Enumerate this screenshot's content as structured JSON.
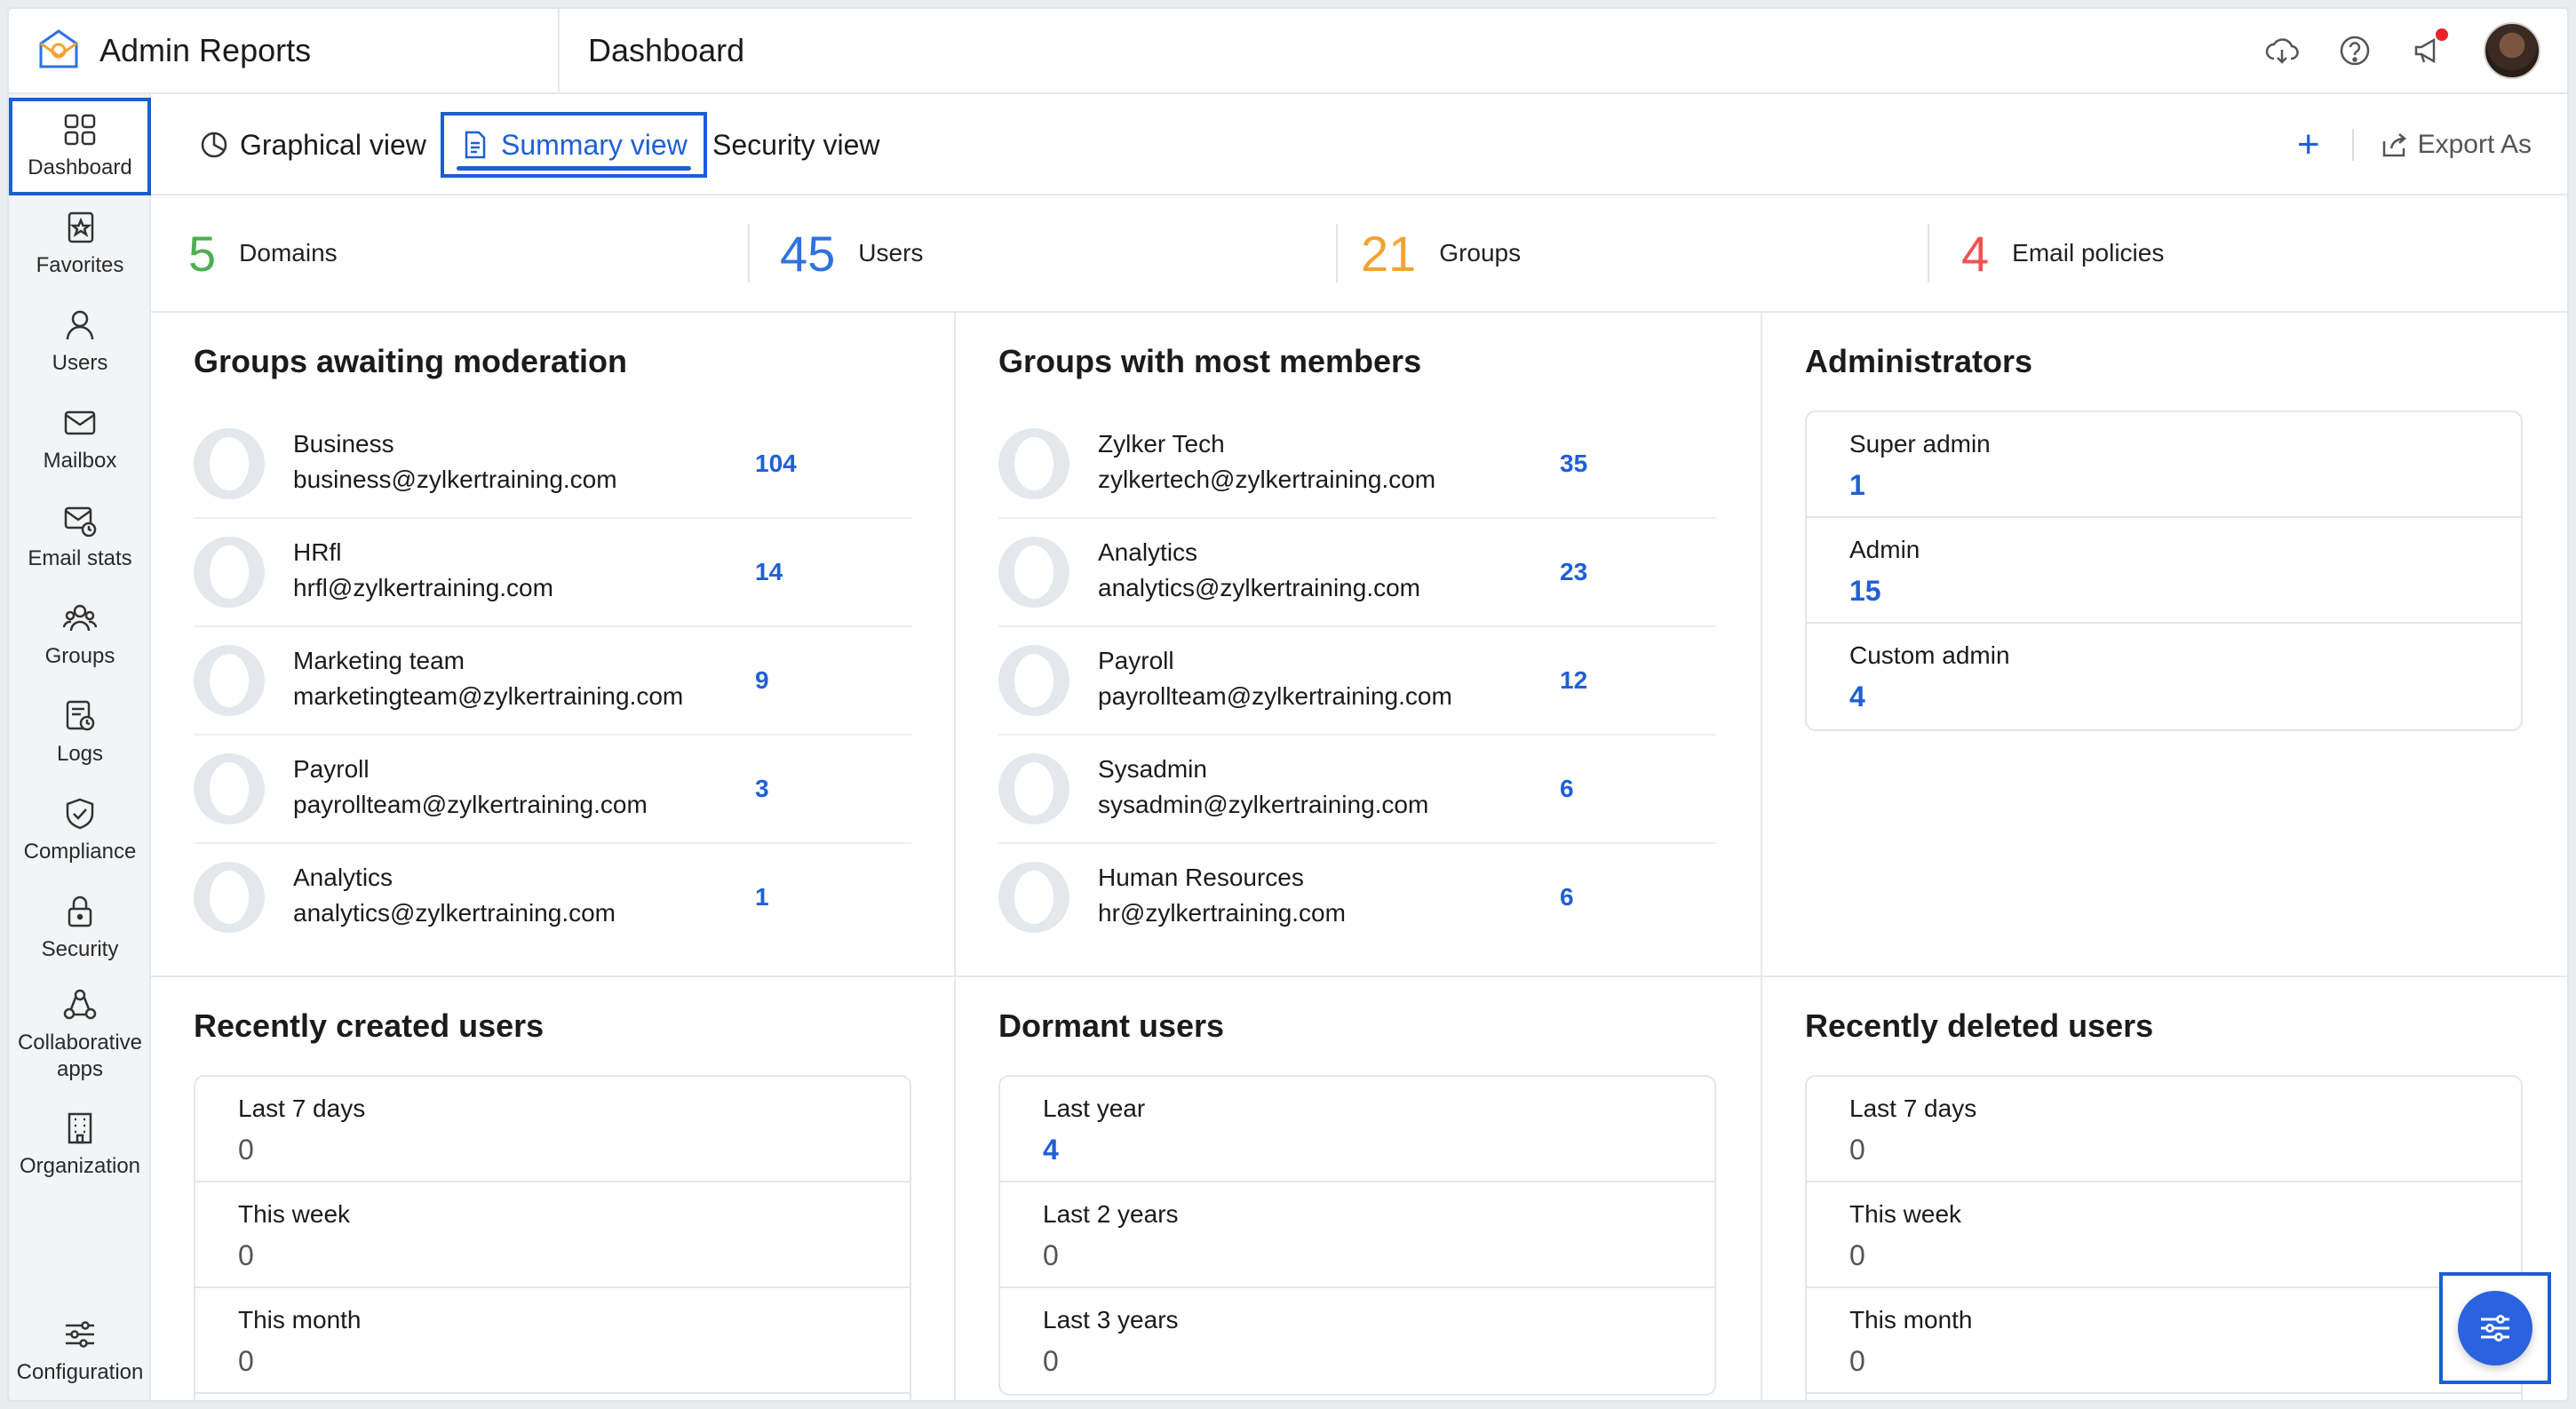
{
  "app": {
    "title": "Admin Reports",
    "page_title": "Dashboard"
  },
  "header": {
    "icons": [
      "cloud-download-icon",
      "help-icon",
      "announcement-icon",
      "avatar"
    ]
  },
  "sidebar": {
    "items": [
      {
        "label": "Dashboard",
        "icon": "dashboard-icon",
        "active": true
      },
      {
        "label": "Favorites",
        "icon": "favorites-icon"
      },
      {
        "label": "Users",
        "icon": "user-icon"
      },
      {
        "label": "Mailbox",
        "icon": "mailbox-icon"
      },
      {
        "label": "Email stats",
        "icon": "email-stats-icon"
      },
      {
        "label": "Groups",
        "icon": "groups-icon"
      },
      {
        "label": "Logs",
        "icon": "logs-icon"
      },
      {
        "label": "Compliance",
        "icon": "compliance-icon"
      },
      {
        "label": "Security",
        "icon": "lock-icon"
      },
      {
        "label": "Collaborative apps",
        "icon": "collab-icon"
      },
      {
        "label": "Organization",
        "icon": "building-icon"
      }
    ],
    "bottom": {
      "label": "Configuration",
      "icon": "sliders-icon"
    }
  },
  "tabs": [
    {
      "label": "Graphical view",
      "icon": "pie-chart-icon"
    },
    {
      "label": "Summary view",
      "icon": "document-icon",
      "active": true
    },
    {
      "label": "Security view"
    }
  ],
  "actions": {
    "add": "+",
    "export": "Export As"
  },
  "stats": [
    {
      "value": "5",
      "label": "Domains",
      "color": "#4caf50"
    },
    {
      "value": "45",
      "label": "Users",
      "color": "#2f72e0"
    },
    {
      "value": "21",
      "label": "Groups",
      "color": "#f5a233"
    },
    {
      "value": "4",
      "label": "Email policies",
      "color": "#ef5350"
    }
  ],
  "moderation": {
    "title": "Groups awaiting moderation",
    "rows": [
      {
        "name": "Business",
        "email": "business@zylkertraining.com",
        "count": "104"
      },
      {
        "name": "HRfl",
        "email": "hrfl@zylkertraining.com",
        "count": "14"
      },
      {
        "name": "Marketing team",
        "email": "marketingteam@zylkertraining.com",
        "count": "9"
      },
      {
        "name": "Payroll",
        "email": "payrollteam@zylkertraining.com",
        "count": "3"
      },
      {
        "name": "Analytics",
        "email": "analytics@zylkertraining.com",
        "count": "1"
      }
    ]
  },
  "most_members": {
    "title": "Groups with most members",
    "rows": [
      {
        "name": "Zylker Tech",
        "email": "zylkertech@zylkertraining.com",
        "count": "35"
      },
      {
        "name": "Analytics",
        "email": "analytics@zylkertraining.com",
        "count": "23"
      },
      {
        "name": "Payroll",
        "email": "payrollteam@zylkertraining.com",
        "count": "12"
      },
      {
        "name": "Sysadmin",
        "email": "sysadmin@zylkertraining.com",
        "count": "6"
      },
      {
        "name": "Human Resources",
        "email": "hr@zylkertraining.com",
        "count": "6"
      }
    ]
  },
  "administrators": {
    "title": "Administrators",
    "items": [
      {
        "label": "Super admin",
        "value": "1"
      },
      {
        "label": "Admin",
        "value": "15"
      },
      {
        "label": "Custom admin",
        "value": "4"
      }
    ]
  },
  "recently_created": {
    "title": "Recently created users",
    "items": [
      {
        "label": "Last 7 days",
        "value": "0"
      },
      {
        "label": "This week",
        "value": "0"
      },
      {
        "label": "This month",
        "value": "0"
      }
    ]
  },
  "dormant": {
    "title": "Dormant users",
    "items": [
      {
        "label": "Last year",
        "value": "4"
      },
      {
        "label": "Last 2 years",
        "value": "0"
      },
      {
        "label": "Last 3 years",
        "value": "0"
      }
    ]
  },
  "recently_deleted": {
    "title": "Recently deleted users",
    "items": [
      {
        "label": "Last 7 days",
        "value": "0"
      },
      {
        "label": "This week",
        "value": "0"
      },
      {
        "label": "This month",
        "value": "0"
      }
    ]
  },
  "colors": {
    "accent": "#1f5fd6",
    "highlight": "#1a5fd1"
  }
}
